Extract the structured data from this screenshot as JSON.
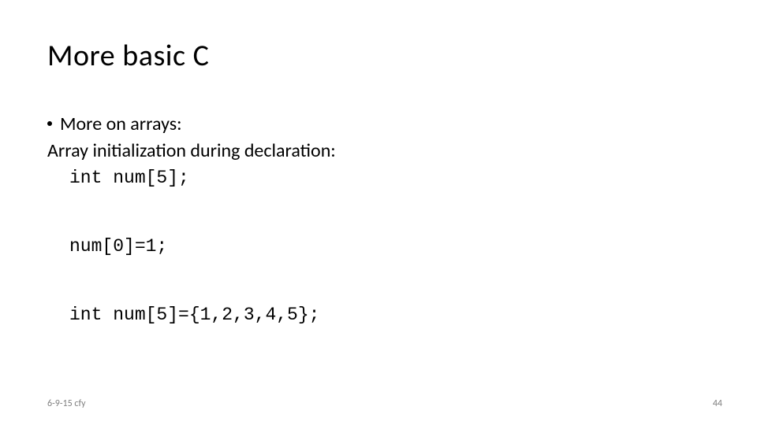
{
  "title": "More basic C",
  "bullet1": "More on arrays:",
  "line1": "Array initialization during declaration:",
  "code1": "int num[5];",
  "code2": "num[0]=1;",
  "code3": "int num[5]={1,2,3,4,5};",
  "footer_left": "6-9-15 cfy",
  "footer_right": "44"
}
